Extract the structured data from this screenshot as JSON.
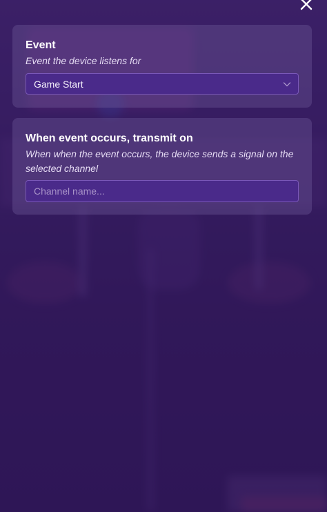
{
  "event_section": {
    "title": "Event",
    "description": "Event the device listens for",
    "selected_event": "Game Start"
  },
  "transmit_section": {
    "title": "When event occurs, transmit on",
    "description": "When when the event occurs, the device sends a signal on the selected channel",
    "channel_value": "",
    "channel_placeholder": "Channel name..."
  },
  "icons": {
    "close": "close-icon",
    "dropdown": "chevron-down-icon"
  },
  "colors": {
    "panel_background": "#3a1e64",
    "field_background": "#4a2a8a",
    "field_border": "#7a58b8",
    "text_primary": "#ffffff",
    "text_secondary": "#e6dcf4"
  }
}
